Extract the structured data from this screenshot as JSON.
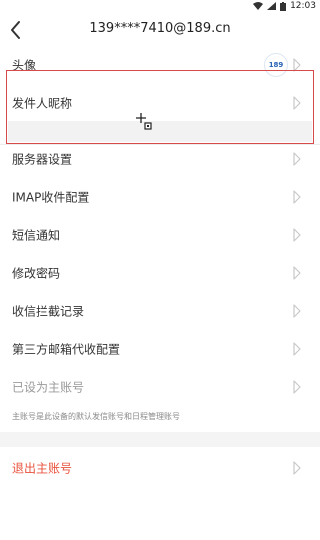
{
  "status": {
    "time": "12:03"
  },
  "header": {
    "title": "139****7410@189.cn"
  },
  "avatar": {
    "label": "头像",
    "badge": "189"
  },
  "items": [
    {
      "label": "发件人昵称"
    },
    {
      "label": "服务器设置"
    },
    {
      "label": "IMAP收件配置"
    },
    {
      "label": "短信通知"
    },
    {
      "label": "修改密码"
    },
    {
      "label": "收信拦截记录"
    },
    {
      "label": "第三方邮箱代收配置"
    },
    {
      "label": "已设为主账号"
    }
  ],
  "note": "主账号是此设备的默认发信账号和日程管理账号",
  "logout": {
    "label": "退出主账号"
  },
  "colors": {
    "highlight": "#d84a4a",
    "logout": "#e8533f",
    "badge": "#2a63b5"
  }
}
